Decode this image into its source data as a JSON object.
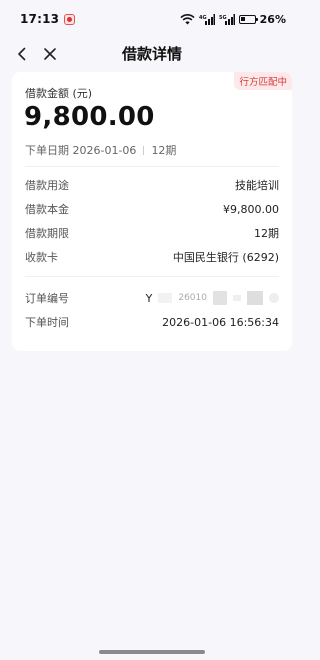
{
  "status_bar": {
    "time": "17:13",
    "battery": "26%"
  },
  "nav": {
    "title": "借款详情"
  },
  "card": {
    "badge": "行方匹配中",
    "amount_label": "借款金额 (元)",
    "amount": "9,800.00",
    "order_date": "下单日期 2026-01-06",
    "term_short": "12期",
    "details": [
      {
        "label": "借款用途",
        "value": "技能培训"
      },
      {
        "label": "借款本金",
        "value": "¥9,800.00"
      },
      {
        "label": "借款期限",
        "value": "12期"
      },
      {
        "label": "收款卡",
        "value": "中国民生银行 (6292)"
      }
    ],
    "order_no_label": "订单编号",
    "order_no_visible_prefix": "Y",
    "order_no_visible_mid": "26010",
    "order_time_label": "下单时间",
    "order_time": "2026-01-06 16:56:34"
  },
  "colors": {
    "page_bg": "#f6f6fb",
    "card_bg": "#ffffff",
    "badge_bg": "#fde9e9",
    "badge_text": "#d83c3c"
  }
}
